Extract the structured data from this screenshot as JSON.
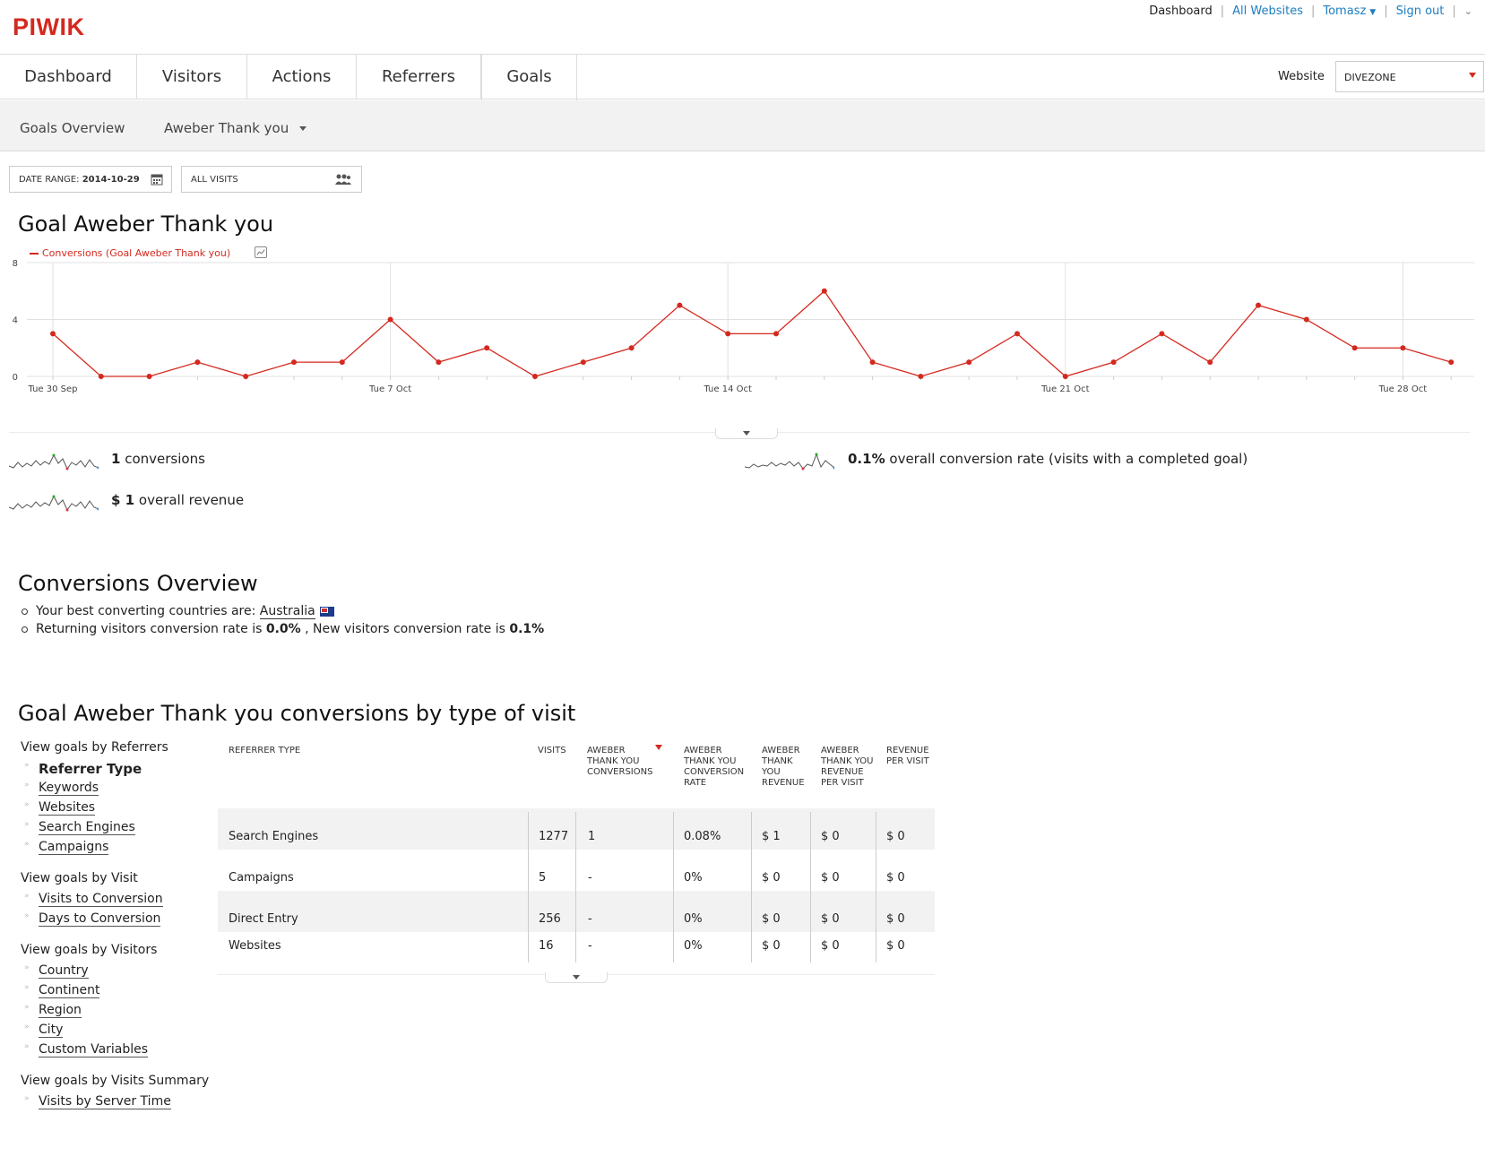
{
  "header": {
    "logo": "PIWIK",
    "nav": {
      "dashboard": "Dashboard",
      "all_websites": "All Websites",
      "user": "Tomasz",
      "sign_out": "Sign out"
    }
  },
  "main_tabs": [
    "Dashboard",
    "Visitors",
    "Actions",
    "Referrers",
    "Goals"
  ],
  "website": {
    "label": "Website",
    "selected": "DIVEZONE"
  },
  "subnav": {
    "overview": "Goals Overview",
    "goal": "Aweber Thank you"
  },
  "controls": {
    "date_label": "DATE RANGE:",
    "date_value": "2014-10-29",
    "segment": "ALL VISITS"
  },
  "evolution": {
    "title": "Goal Aweber Thank you",
    "legend": "Conversions (Goal Aweber Thank you)"
  },
  "chart_data": {
    "type": "line",
    "series": [
      {
        "name": "Conversions (Goal Aweber Thank you)",
        "values": [
          3,
          0,
          0,
          1,
          0,
          1,
          1,
          4,
          1,
          2,
          0,
          1,
          2,
          5,
          3,
          3,
          6,
          1,
          0,
          1,
          3,
          0,
          1,
          3,
          1,
          5,
          4,
          2,
          2,
          1
        ]
      }
    ],
    "x": [
      "2014-09-30",
      "2014-10-01",
      "2014-10-02",
      "2014-10-03",
      "2014-10-04",
      "2014-10-05",
      "2014-10-06",
      "2014-10-07",
      "2014-10-08",
      "2014-10-09",
      "2014-10-10",
      "2014-10-11",
      "2014-10-12",
      "2014-10-13",
      "2014-10-14",
      "2014-10-15",
      "2014-10-16",
      "2014-10-17",
      "2014-10-18",
      "2014-10-19",
      "2014-10-20",
      "2014-10-21",
      "2014-10-22",
      "2014-10-23",
      "2014-10-24",
      "2014-10-25",
      "2014-10-26",
      "2014-10-27",
      "2014-10-28",
      "2014-10-29"
    ],
    "x_tick_labels": [
      "Tue 30 Sep",
      "Tue 7 Oct",
      "Tue 14 Oct",
      "Tue 21 Oct",
      "Tue 28 Oct"
    ],
    "y_ticks": [
      "0",
      "4",
      "8"
    ],
    "ylim": [
      0,
      8
    ],
    "grid": true,
    "color": "#d4291f"
  },
  "metrics": {
    "conversions_value": "1",
    "conversions_label": "conversions",
    "rate_value": "0.1%",
    "rate_label": "overall conversion rate (visits with a completed goal)",
    "revenue_value": "$ 1",
    "revenue_label": "overall revenue"
  },
  "overview": {
    "title": "Conversions Overview",
    "best_prefix": "Your best converting countries are:",
    "best_country": "Australia",
    "returning_prefix": "Returning visitors conversion rate is",
    "returning_value": "0.0%",
    "new_prefix": ", New visitors conversion rate is",
    "new_value": "0.1%"
  },
  "by_type": {
    "title": "Goal Aweber Thank you conversions by type of visit",
    "groups": [
      {
        "title": "View goals by Referrers",
        "items": [
          "Referrer Type",
          "Keywords",
          "Websites",
          "Search Engines",
          "Campaigns"
        ]
      },
      {
        "title": "View goals by Visit",
        "items": [
          "Visits to Conversion",
          "Days to Conversion"
        ]
      },
      {
        "title": "View goals by Visitors",
        "items": [
          "Country",
          "Continent",
          "Region",
          "City",
          "Custom Variables"
        ]
      },
      {
        "title": "View goals by Visits Summary",
        "items": [
          "Visits by Server Time"
        ]
      }
    ],
    "columns": [
      "REFERRER TYPE",
      "VISITS",
      "AWEBER THANK YOU CONVERSIONS",
      "AWEBER THANK YOU CONVERSION RATE",
      "AWEBER THANK YOU REVENUE",
      "AWEBER THANK YOU REVENUE PER VISIT",
      "REVENUE PER VISIT"
    ],
    "rows": [
      [
        "Search Engines",
        "1277",
        "1",
        "0.08%",
        "$ 1",
        "$ 0",
        "$ 0"
      ],
      [
        "Campaigns",
        "5",
        "-",
        "0%",
        "$ 0",
        "$ 0",
        "$ 0"
      ],
      [
        "Direct Entry",
        "256",
        "-",
        "0%",
        "$ 0",
        "$ 0",
        "$ 0"
      ],
      [
        "Websites",
        "16",
        "-",
        "0%",
        "$ 0",
        "$ 0",
        "$ 0"
      ]
    ]
  }
}
